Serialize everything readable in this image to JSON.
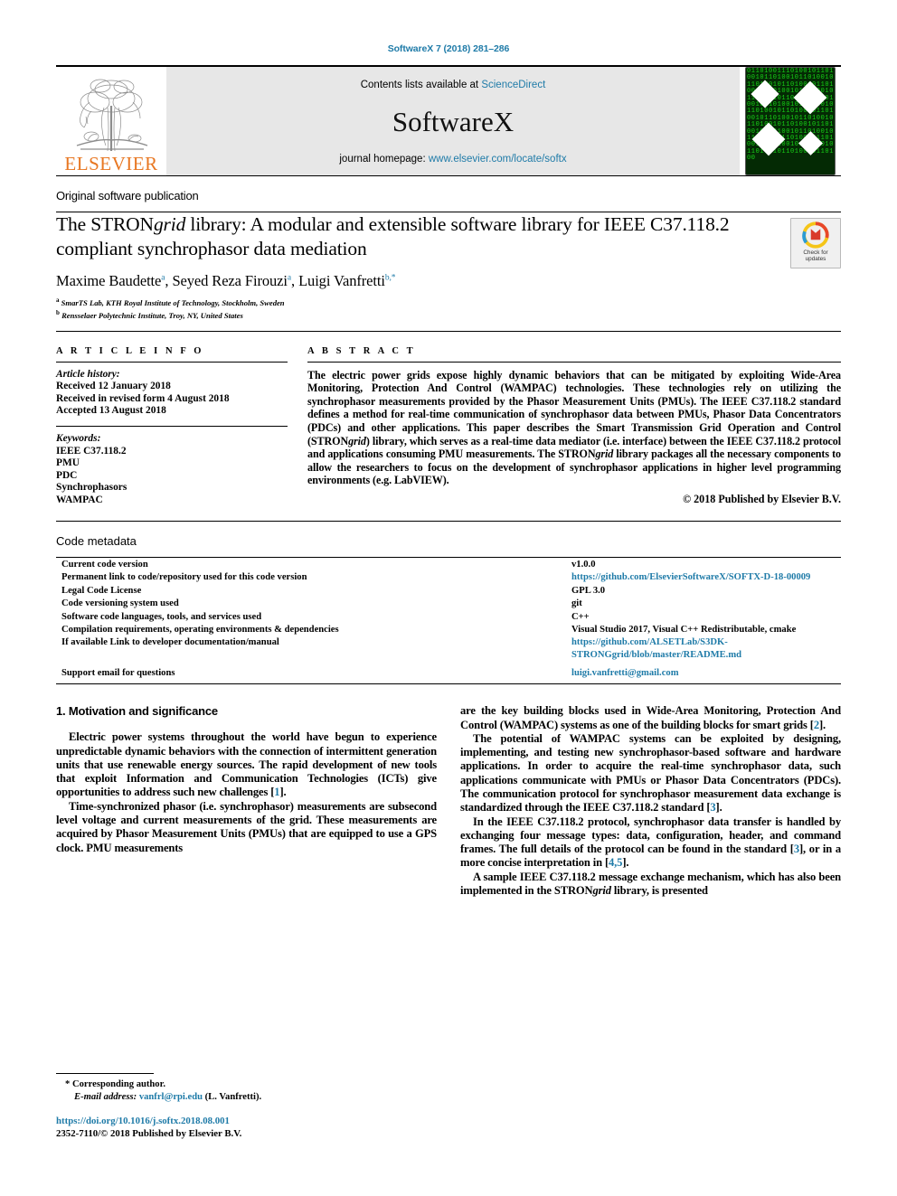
{
  "running_head": "SoftwareX 7 (2018) 281–286",
  "masthead": {
    "contents_prefix": "Contents lists available at ",
    "contents_link": "ScienceDirect",
    "journal_name": "SoftwareX",
    "homepage_prefix": "journal homepage: ",
    "homepage_link": "www.elsevier.com/locate/softx",
    "publisher_wordmark": "ELSEVIER",
    "cover_alt": "softwarex-cover-binary-diamonds"
  },
  "article": {
    "publication_type": "Original software publication",
    "title_line1_pre": "The STRON",
    "title_line1_ital": "grid",
    "title_line1_post": " library: A modular and extensible software library for",
    "title_line2": "IEEE C37.118.2 compliant synchrophasor data mediation",
    "authors": [
      {
        "name": "Maxime Baudette",
        "sup": "a"
      },
      {
        "name": "Seyed Reza Firouzi",
        "sup": "a"
      },
      {
        "name": "Luigi Vanfretti",
        "sup": "b,*"
      }
    ],
    "affiliations": [
      {
        "marker": "a",
        "text": "SmarTS Lab, KTH Royal Institute of Technology, Stockholm, Sweden"
      },
      {
        "marker": "b",
        "text": "Rensselaer Polytechnic Institute, Troy, NY, United States"
      }
    ],
    "crossmark_label_line1": "Check for",
    "crossmark_label_line2": "updates"
  },
  "article_info": {
    "heading": "A R T I C L E   I N F O",
    "history_label": "Article history:",
    "history": [
      "Received 12 January 2018",
      "Received in revised form 4 August 2018",
      "Accepted 13 August 2018"
    ],
    "keywords_label": "Keywords:",
    "keywords": [
      "IEEE C37.118.2",
      "PMU",
      "PDC",
      "Synchrophasors",
      "WAMPAC"
    ]
  },
  "abstract": {
    "heading": "A B S T R A C T",
    "part1": "The electric power grids expose highly dynamic behaviors that can be mitigated by exploiting Wide-Area Monitoring, Protection And Control (WAMPAC) technologies. These technologies rely on utilizing the synchrophasor measurements provided by the Phasor Measurement Units (PMUs). The IEEE C37.118.2 standard defines a method for real-time communication of synchrophasor data between PMUs, Phasor Data Concentrators (PDCs) and other applications. This paper describes the Smart Transmission Grid Operation and Control (STRON",
    "ital1": "grid",
    "part2": ") library, which serves as a real-time data mediator (i.e. interface) between the IEEE C37.118.2 protocol and applications consuming PMU measurements. The STRON",
    "ital2": "grid",
    "part3": " library packages all the necessary components to allow the researchers to focus on the development of synchrophasor applications in higher level programming environments (e.g. LabVIEW).",
    "copyright": "© 2018 Published by Elsevier B.V."
  },
  "code_metadata": {
    "heading": "Code metadata",
    "rows": [
      {
        "key": "Current code version",
        "value": "v1.0.0",
        "link": false
      },
      {
        "key": "Permanent link to code/repository used for this code version",
        "value": "https://github.com/ElsevierSoftwareX/SOFTX-D-18-00009",
        "link": true
      },
      {
        "key": "Legal Code License",
        "value": "GPL 3.0",
        "link": false
      },
      {
        "key": "Code versioning system used",
        "value": "git",
        "link": false
      },
      {
        "key": "Software code languages, tools, and services used",
        "value": "C++",
        "link": false
      },
      {
        "key": "Compilation requirements, operating environments & dependencies",
        "value": "Visual Studio 2017, Visual C++ Redistributable, cmake",
        "link": false
      },
      {
        "key": "If available Link to developer documentation/manual",
        "value": "https://github.com/ALSETLab/S3DK-STRONGgrid/blob/master/README.md",
        "link": true
      },
      {
        "key": "Support email for questions",
        "value": "luigi.vanfretti@gmail.com",
        "link": true,
        "pad_top": true
      }
    ]
  },
  "body": {
    "section1_heading": "1. Motivation and significance",
    "left_paragraphs": [
      {
        "pre": "Electric power systems throughout the world have begun to experience unpredictable dynamic behaviors with the connection of intermittent generation units that use renewable energy sources. The rapid development of new tools that exploit Information and Communication Technologies (ICTs) give opportunities to address such new challenges [",
        "ref": "1",
        "post": "]."
      },
      {
        "pre": "Time-synchronized phasor (i.e. synchrophasor) measurements are subsecond level voltage and current measurements of the grid. These measurements are acquired by Phasor Measurement Units (PMUs) that are equipped to use a GPS clock. PMU measurements",
        "ref": "",
        "post": ""
      }
    ],
    "right_paragraphs": [
      {
        "pre": "are the key building blocks used in Wide-Area Monitoring, Protection And Control (WAMPAC) systems as one of the building blocks for smart grids [",
        "ref": "2",
        "post": "]."
      },
      {
        "pre": "The potential of WAMPAC systems can be exploited by designing, implementing, and testing new synchrophasor-based software and hardware applications. In order to acquire the real-time synchrophasor data, such applications communicate with PMUs or Phasor Data Concentrators (PDCs). The communication protocol for synchrophasor measurement data exchange is standardized through the IEEE C37.118.2 standard [",
        "ref": "3",
        "post": "]."
      },
      {
        "pre": "In the IEEE C37.118.2 protocol, synchrophasor data transfer is handled by exchanging four message types: data, configuration, header, and command frames. The full details of the protocol can be found in the standard [",
        "ref": "3",
        "mid": "], or in a more concise interpretation in [",
        "ref2": "4,5",
        "post": "]."
      },
      {
        "pre": "A sample IEEE C37.118.2 message exchange mechanism, which has also been implemented in the STRON",
        "ital": "grid",
        "post": " library, is presented"
      }
    ]
  },
  "footnote": {
    "corresponding_marker": "*",
    "corresponding_text": "Corresponding author.",
    "email_label": "E-mail address:",
    "email": "vanfrl@rpi.edu",
    "email_suffix": "(L. Vanfretti).",
    "doi": "https://doi.org/10.1016/j.softx.2018.08.001",
    "issn_line": "2352-7110/© 2018 Published by Elsevier B.V."
  },
  "colors": {
    "link": "#1f7ba8",
    "elsevier_orange": "#e87722",
    "masthead_bg": "#e7e7e7"
  }
}
